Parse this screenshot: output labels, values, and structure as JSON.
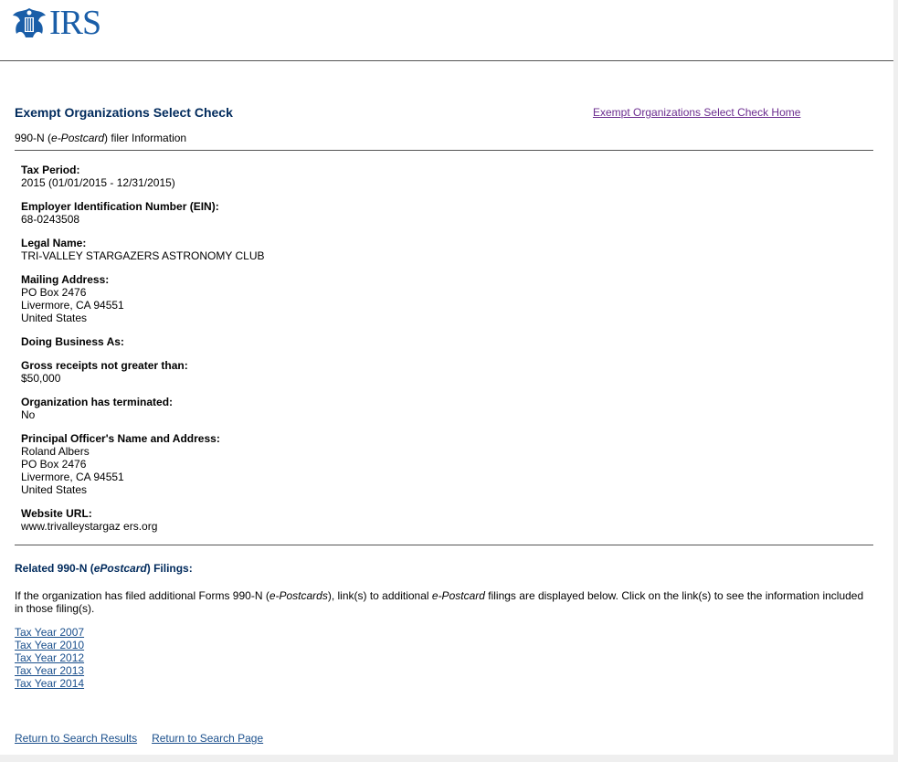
{
  "header": {
    "logo_text": "IRS",
    "colors": {
      "brand_blue": "#1a5ea8",
      "title_navy": "#002a5c",
      "visited_link": "#6b2c8f"
    }
  },
  "page": {
    "title": "Exempt Organizations Select Check",
    "home_link": "Exempt Organizations Select Check Home",
    "subtitle_prefix": "990-N (",
    "subtitle_italic": "e-Postcard",
    "subtitle_suffix": ") filer Information"
  },
  "fields": {
    "tax_period": {
      "label": "Tax Period:",
      "value": "2015 (01/01/2015 - 12/31/2015)"
    },
    "ein": {
      "label": "Employer Identification Number (EIN):",
      "value": "68-0243508"
    },
    "legal_name": {
      "label": "Legal Name:",
      "value": "TRI-VALLEY STARGAZERS ASTRONOMY CLUB"
    },
    "mailing_address": {
      "label": "Mailing Address:",
      "line1": "PO Box 2476",
      "line2": "Livermore, CA 94551",
      "line3": "United States"
    },
    "dba": {
      "label": "Doing Business As:"
    },
    "gross_receipts": {
      "label": "Gross receipts not greater than:",
      "value": "$50,000"
    },
    "terminated": {
      "label": "Organization has terminated:",
      "value": "No"
    },
    "principal_officer": {
      "label": "Principal Officer's Name and Address:",
      "line1": "Roland Albers",
      "line2": "PO Box 2476",
      "line3": "Livermore, CA 94551",
      "line4": "United States"
    },
    "website": {
      "label": "Website URL:",
      "value": "www.trivalleystargaz ers.org"
    }
  },
  "related": {
    "heading_prefix": "Related 990-N (",
    "heading_italic": "ePostcard",
    "heading_suffix": ") Filings:",
    "desc_part1": "If the organization has filed additional Forms 990-N (",
    "desc_italic1": "e-Postcards",
    "desc_part2": "), link(s) to additional ",
    "desc_italic2": "e-Postcard",
    "desc_part3": " filings are displayed below. Click on the link(s) to see the information included in those filing(s).",
    "years": [
      "Tax Year 2007",
      "Tax Year 2010",
      "Tax Year 2012",
      "Tax Year 2013",
      "Tax Year 2014"
    ]
  },
  "footer": {
    "return_results": "Return to Search Results",
    "return_search": "Return to Search Page"
  }
}
